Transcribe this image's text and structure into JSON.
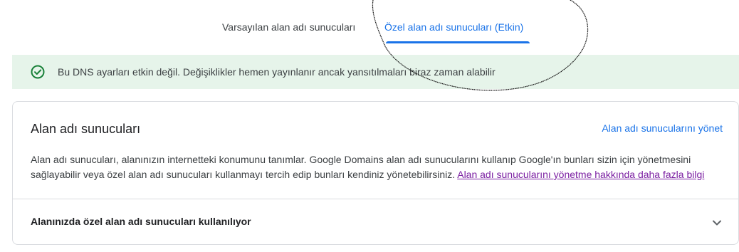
{
  "tabs": [
    {
      "label": "Varsayılan alan adı sunucuları"
    },
    {
      "label": "Özel alan adı sunucuları (Etkin)"
    }
  ],
  "banner": {
    "icon": "check-circle-icon",
    "text": "Bu DNS ayarları etkin değil. Değişiklikler hemen yayınlanır ancak yansıtılmaları biraz zaman alabilir"
  },
  "card": {
    "title": "Alan adı sunucuları",
    "manage_link": "Alan adı sunucularını yönet",
    "description": "Alan adı sunucuları, alanınızın internetteki konumunu tanımlar. Google Domains alan adı sunucularını kullanıp Google'ın bunları sizin için yönetmesini sağlayabilir veya özel alan adı sunucuları kullanmayı tercih edip bunları kendiniz yönetebilirsiniz.",
    "learn_more_link": "Alan adı sunucularını yönetme hakkında daha fazla bilgi",
    "row_title": "Alanınızda özel alan adı sunucuları kullanılıyor",
    "row_icon": "chevron-down-icon"
  },
  "colors": {
    "accent": "#1a73e8",
    "success_bg": "#e6f4ea",
    "success_icon": "#188038",
    "visited_link": "#7b1fa2"
  }
}
